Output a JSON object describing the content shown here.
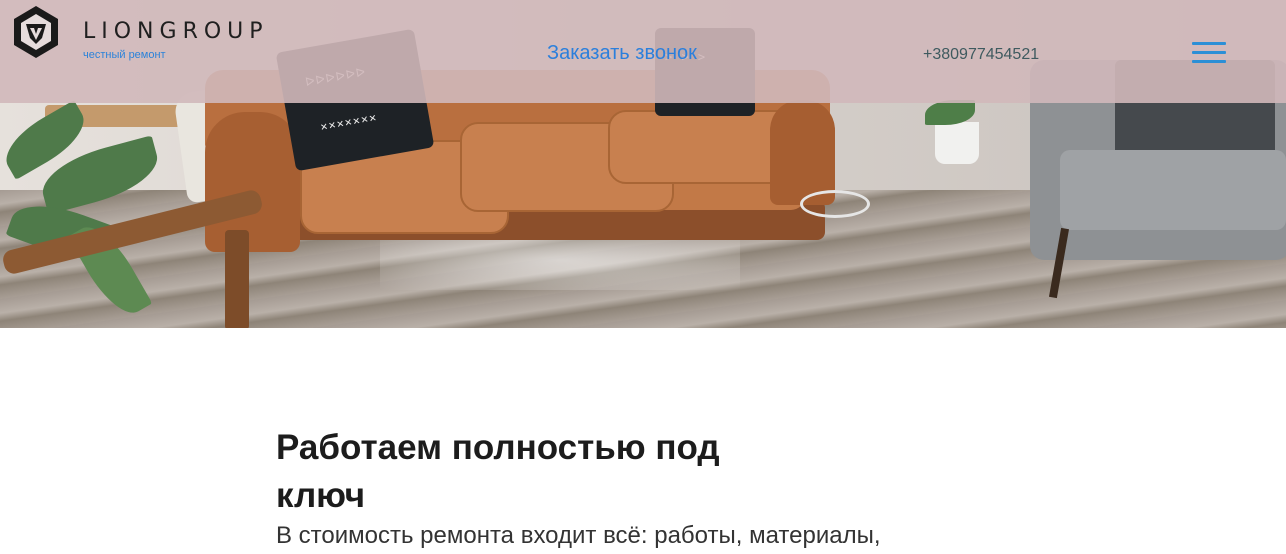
{
  "header": {
    "logo_text": "LIONGROUP",
    "logo_subtitle": "честный ремонт",
    "cta_label": "Заказать звонок",
    "phone": "+380977454521",
    "menu_icon": "hamburger-menu-icon",
    "accent_color": "#2b7fdc",
    "bar_color": "#d0b8ba"
  },
  "hero": {
    "image": "living-room-leather-sofa-photo"
  },
  "content": {
    "heading": "Работаем полностью под ключ",
    "lead": "В стоимость ремонта входит всё: работы, материалы,"
  }
}
